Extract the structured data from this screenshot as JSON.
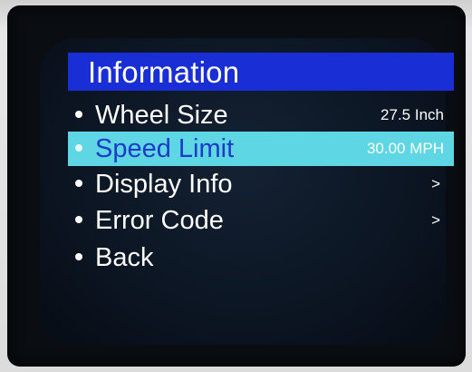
{
  "menu": {
    "title": "Information",
    "items": [
      {
        "label": "Wheel Size",
        "value": "27.5 Inch",
        "arrow": ""
      },
      {
        "label": "Speed Limit",
        "value": "30.00 MPH",
        "arrow": ""
      },
      {
        "label": "Display Info",
        "value": "",
        "arrow": ">"
      },
      {
        "label": "Error Code",
        "value": "",
        "arrow": ">"
      },
      {
        "label": "Back",
        "value": "",
        "arrow": ""
      }
    ],
    "selected_index": 1
  },
  "colors": {
    "title_bar": "#1a2ed6",
    "highlight": "#5ed6e3",
    "highlight_text": "#1c3cc8",
    "screen_bg": "#0c1624",
    "text": "#ffffff"
  }
}
